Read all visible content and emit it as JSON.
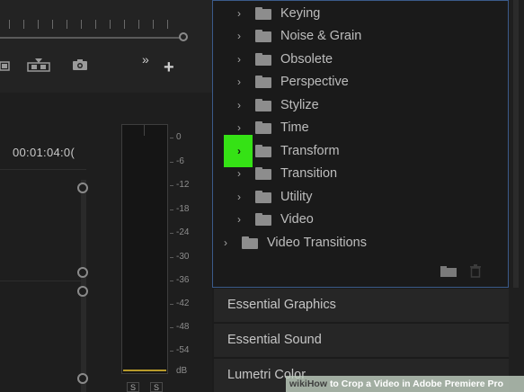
{
  "program_monitor": {
    "timecode": "00:01:04:0("
  },
  "audio_meter": {
    "db_scale": [
      "0",
      "-6",
      "-12",
      "-18",
      "-24",
      "-30",
      "-36",
      "-42",
      "-48",
      "-54",
      "dB"
    ],
    "solo_labels": [
      "S",
      "S"
    ]
  },
  "effects_tree": {
    "items": [
      {
        "label": "Keying",
        "indent": 1
      },
      {
        "label": "Noise & Grain",
        "indent": 1
      },
      {
        "label": "Obsolete",
        "indent": 1
      },
      {
        "label": "Perspective",
        "indent": 1
      },
      {
        "label": "Stylize",
        "indent": 1
      },
      {
        "label": "Time",
        "indent": 1
      },
      {
        "label": "Transform",
        "indent": 1,
        "highlighted": true
      },
      {
        "label": "Transition",
        "indent": 1
      },
      {
        "label": "Utility",
        "indent": 1
      },
      {
        "label": "Video",
        "indent": 1
      },
      {
        "label": "Video Transitions",
        "indent": 0
      }
    ],
    "highlight_color": "#35e215"
  },
  "panels": {
    "essential_graphics": "Essential Graphics",
    "essential_sound": "Essential Sound",
    "lumetri_color": "Lumetri Color"
  },
  "watermark": {
    "wiki": "wiki",
    "how": "How",
    "title": "to Crop a Video in Adobe Premiere Pro"
  },
  "icons": {
    "toolbar": [
      "insert-icon",
      "overwrite-icon",
      "export-frame-icon",
      "more-icon",
      "add-icon"
    ],
    "effects_footer": [
      "new-bin-icon",
      "trash-icon"
    ]
  }
}
